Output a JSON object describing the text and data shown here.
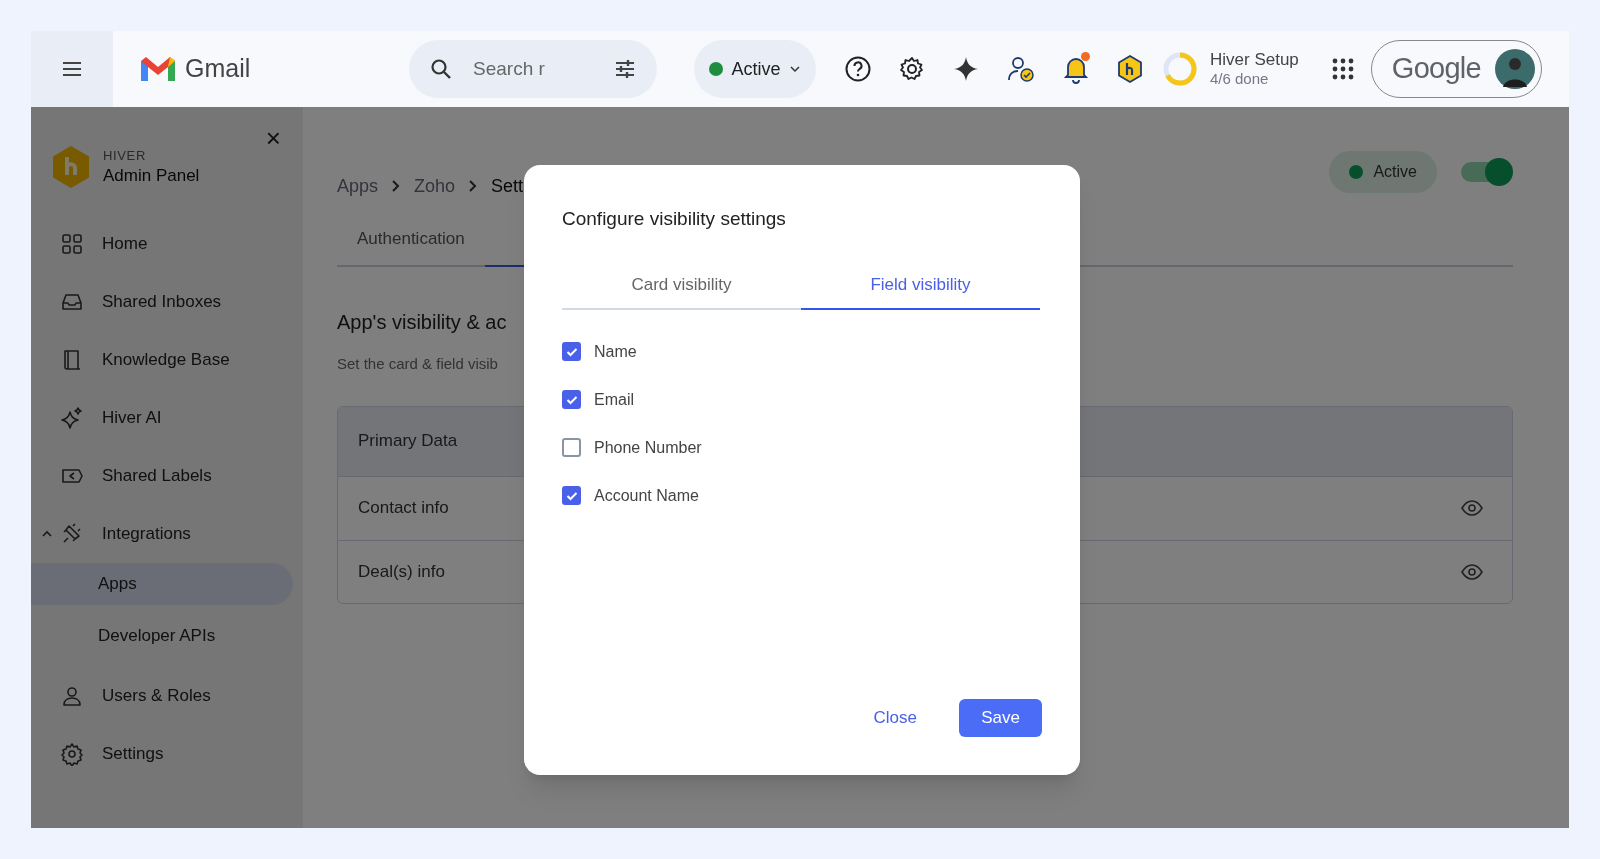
{
  "topbar": {
    "app_name": "Gmail",
    "search": {
      "placeholder": "Search r"
    },
    "status": {
      "label": "Active"
    },
    "account_logo": "Google",
    "notifications_unread": true,
    "setup": {
      "title": "Hiver Setup",
      "progress": "4/6 done",
      "level": 0.67
    }
  },
  "sidebar": {
    "brand_top": "HIVER",
    "brand_title": "Admin Panel",
    "close": "×",
    "items": [
      {
        "label": "Home",
        "selected": false
      },
      {
        "label": "Shared Inboxes",
        "selected": false
      },
      {
        "label": "Knowledge Base",
        "selected": false
      },
      {
        "label": "Hiver AI",
        "selected": false
      },
      {
        "label": "Shared Labels",
        "selected": false
      },
      {
        "label": "Integrations",
        "selected": false,
        "expanded": true,
        "children": [
          {
            "label": "Apps",
            "selected": true
          },
          {
            "label": "Developer APIs",
            "selected": false
          }
        ]
      },
      {
        "label": "Users & Roles",
        "selected": false
      },
      {
        "label": "Settings",
        "selected": false
      }
    ]
  },
  "page": {
    "breadcrumb": [
      "Apps",
      "Zoho",
      "Sett"
    ],
    "status_badge": {
      "label": "Active"
    },
    "toggle": {
      "on": true
    },
    "tabs": [
      {
        "label": "Authentication",
        "selected": false
      }
    ],
    "heading": "App's visibility & ac",
    "subheading": "Set the card & field visib",
    "table": {
      "header": "Primary Data",
      "rows": [
        {
          "label": "Contact info"
        },
        {
          "label": "Deal(s) info"
        }
      ]
    }
  },
  "dialog": {
    "title": "Configure visibility settings",
    "tabs": [
      {
        "label": "Card visibility",
        "selected": false
      },
      {
        "label": "Field visibility",
        "selected": true
      }
    ],
    "fields": [
      {
        "label": "Name",
        "checked": true
      },
      {
        "label": "Email",
        "checked": true
      },
      {
        "label": "Phone Number",
        "checked": false
      },
      {
        "label": "Account Name",
        "checked": true
      }
    ],
    "buttons": [
      {
        "label": "Close",
        "kind": "text"
      },
      {
        "label": "Save",
        "kind": "primary"
      }
    ]
  }
}
